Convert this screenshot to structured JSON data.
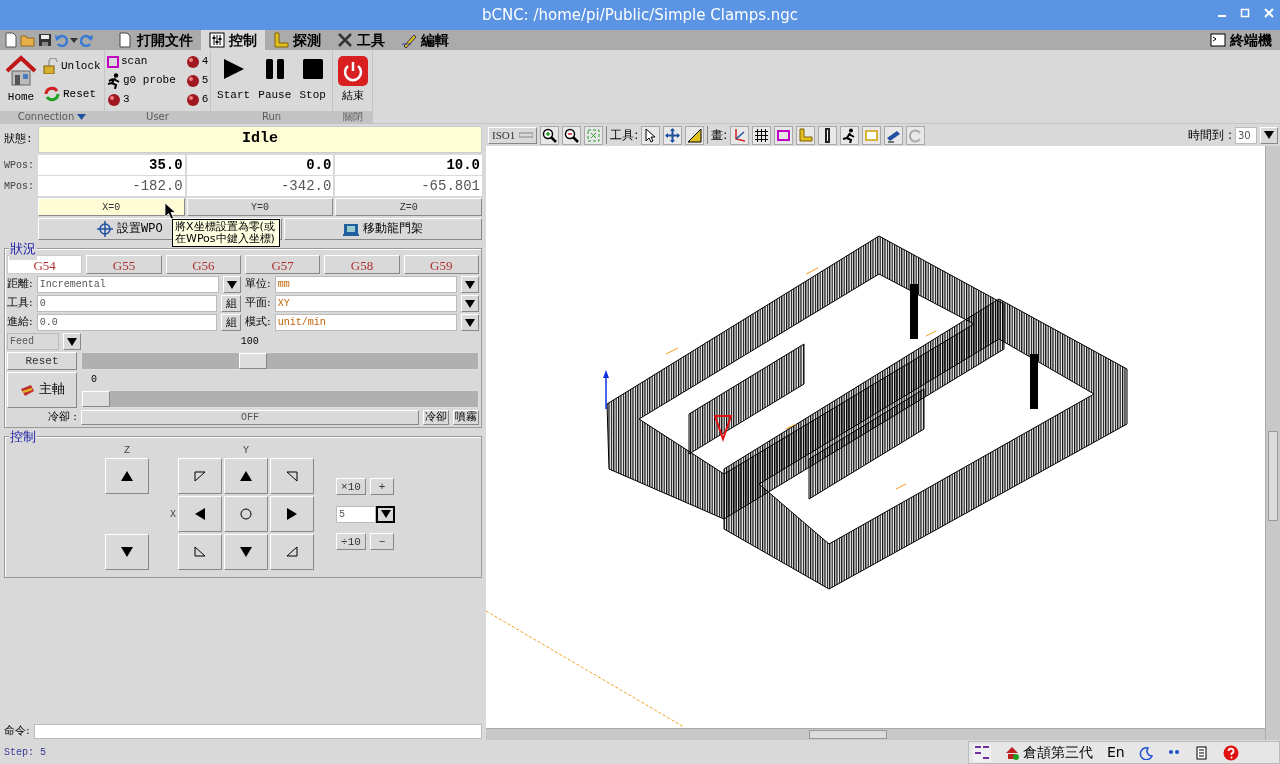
{
  "window": {
    "title": "bCNC: /home/pi/Public/Simple Clamps.ngc"
  },
  "menu_tabs": [
    {
      "label": "打開文件",
      "selected": false
    },
    {
      "label": "控制",
      "selected": true
    },
    {
      "label": "探測",
      "selected": false
    },
    {
      "label": "工具",
      "selected": false
    },
    {
      "label": "編輯",
      "selected": false
    }
  ],
  "terminal_tab": {
    "label": "終端機"
  },
  "ribbon": [
    {
      "kind": "connection",
      "title": "Connection",
      "buttons": [
        {
          "label": "Home"
        },
        {
          "label": "Unlock"
        },
        {
          "label": "Reset"
        }
      ]
    },
    {
      "kind": "user",
      "title": "User",
      "buttons": [
        {
          "kind": "scan",
          "label": "scan"
        },
        {
          "kind": "macro",
          "label": "4"
        },
        {
          "kind": "probe",
          "label": "g0 probe"
        },
        {
          "kind": "macro",
          "label": "5"
        },
        {
          "kind": "macro",
          "label": "3"
        },
        {
          "kind": "macro",
          "label": "6"
        }
      ]
    },
    {
      "kind": "run",
      "title": "Run",
      "buttons": [
        {
          "label": "Start"
        },
        {
          "label": "Pause"
        },
        {
          "label": "Stop"
        }
      ]
    },
    {
      "kind": "close",
      "title": "關閉",
      "buttons": [
        {
          "label": "結束"
        }
      ]
    }
  ],
  "status": {
    "label": "狀態:",
    "value": "Idle"
  },
  "positions": {
    "wpos_label": "WPos:",
    "wpos": [
      "35.0",
      "0.0",
      "10.0"
    ],
    "mpos_label": "MPos:",
    "mpos": [
      "-182.0",
      "-342.0",
      "-65.801"
    ]
  },
  "zero_buttons": [
    {
      "label": "X=0",
      "highlighted": true
    },
    {
      "label": "Y=0",
      "highlighted": false
    },
    {
      "label": "Z=0",
      "highlighted": false
    }
  ],
  "wcs_buttons": [
    {
      "label": "設置WPO"
    },
    {
      "label": "移動龍門架"
    }
  ],
  "tooltip": {
    "text": "將X坐標設置為零(或在WPos中鍵入坐標)"
  },
  "state_panel": {
    "title": "狀況",
    "wcs_tabs": [
      {
        "label": "G54",
        "selected": true
      },
      {
        "label": "G55",
        "selected": false
      },
      {
        "label": "G56",
        "selected": false
      },
      {
        "label": "G57",
        "selected": false
      },
      {
        "label": "G58",
        "selected": false
      },
      {
        "label": "G59",
        "selected": false
      }
    ],
    "fields": [
      {
        "label": "距離:",
        "value": "Incremental",
        "kind": "dropdown"
      },
      {
        "label": "單位:",
        "value": "mm",
        "kind": "dropdown"
      },
      {
        "label": "工具:",
        "value": "0",
        "kind": "button",
        "button": "組"
      },
      {
        "label": "平面:",
        "value": "XY",
        "kind": "dropdown"
      },
      {
        "label": "進給:",
        "value": "0.0",
        "kind": "button",
        "button": "組"
      },
      {
        "label": "模式:",
        "value": "unit/min",
        "kind": "dropdown"
      }
    ],
    "override": {
      "mode": "Feed",
      "value": "100",
      "reset": "Reset",
      "level": 0.43
    },
    "spindle": {
      "label": "主軸",
      "value": "0",
      "level": 0
    },
    "coolant": {
      "label": "冷卻 :",
      "value": "OFF",
      "buttons": [
        "冷卻",
        "噴霧"
      ]
    }
  },
  "jog": {
    "title": "控制",
    "z_label": "Z",
    "y_label": "Y",
    "x_label": "X",
    "step": "5",
    "step_buttons": [
      "×10",
      "+",
      "÷10",
      "−"
    ]
  },
  "command": {
    "label": "命令:"
  },
  "canvas_toolbar": {
    "view": "ISO1",
    "tools_label": "工具:",
    "draw_label": "畫:",
    "time_label": "時間到 :",
    "time_value": "30"
  },
  "status_bar": {
    "text": "Step: 5"
  },
  "tray": {
    "ime": "倉頡第三代",
    "language": "En"
  }
}
